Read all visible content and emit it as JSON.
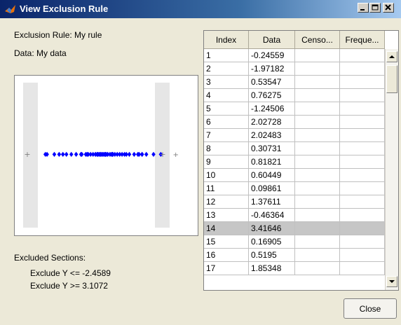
{
  "window": {
    "title": "View Exclusion Rule",
    "minimize_icon": "minimize-icon",
    "maximize_icon": "maximize-icon",
    "close_icon": "close-icon"
  },
  "info": {
    "exclusion_rule": "Exclusion Rule: My rule",
    "data": "Data: My data"
  },
  "excluded": {
    "heading": "Excluded Sections:",
    "rules": [
      "Exclude Y <= -2.4589",
      "Exclude Y >= 3.1072"
    ]
  },
  "table": {
    "columns": [
      "Index",
      "Data",
      "Censo...",
      "Freque..."
    ],
    "selected_index": "14",
    "rows": [
      [
        "1",
        "-0.24559",
        "",
        ""
      ],
      [
        "2",
        "-1.97182",
        "",
        ""
      ],
      [
        "3",
        "0.53547",
        "",
        ""
      ],
      [
        "4",
        "0.76275",
        "",
        ""
      ],
      [
        "5",
        "-1.24506",
        "",
        ""
      ],
      [
        "6",
        "2.02728",
        "",
        ""
      ],
      [
        "7",
        "2.02483",
        "",
        ""
      ],
      [
        "8",
        "0.30731",
        "",
        ""
      ],
      [
        "9",
        "0.81821",
        "",
        ""
      ],
      [
        "10",
        "0.60449",
        "",
        ""
      ],
      [
        "11",
        "0.09861",
        "",
        ""
      ],
      [
        "12",
        "1.37611",
        "",
        ""
      ],
      [
        "13",
        "-0.46364",
        "",
        ""
      ],
      [
        "14",
        "3.41646",
        "",
        ""
      ],
      [
        "15",
        "0.16905",
        "",
        ""
      ],
      [
        "16",
        "0.5195",
        "",
        ""
      ],
      [
        "17",
        "1.85348",
        "",
        ""
      ]
    ]
  },
  "buttons": {
    "close": "Close"
  },
  "colors": {
    "marker": "#0000ff",
    "excluded_marker": "#808080",
    "exclusion_band": "#e6e6e6"
  }
}
